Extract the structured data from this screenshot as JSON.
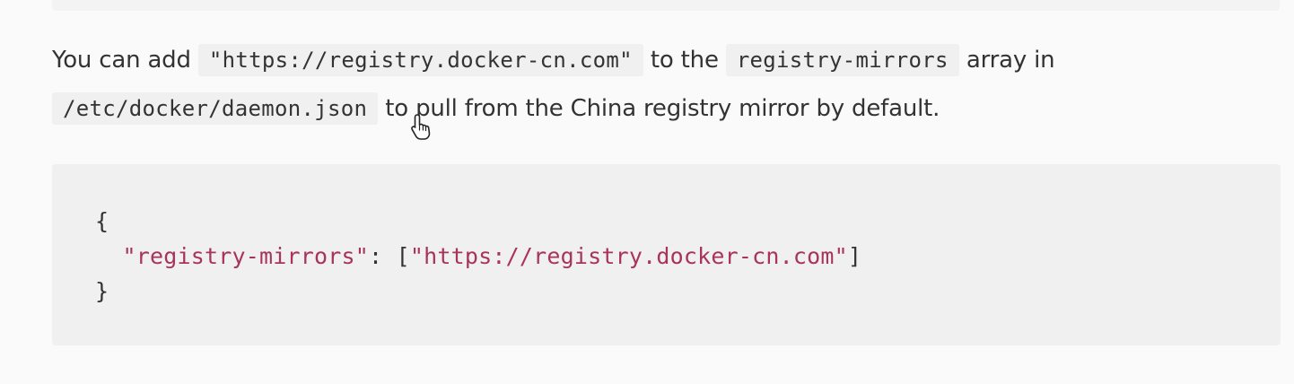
{
  "paragraph": {
    "text_1": "You can add ",
    "code_1": "\"https://registry.docker-cn.com\"",
    "text_2": " to the ",
    "code_2": "registry-mirrors",
    "text_3": " array in",
    "code_3": "/etc/docker/daemon.json",
    "text_4": " to pull from the China registry mirror by default."
  },
  "code_block": {
    "open_brace": "{",
    "indent": "  ",
    "key": "\"registry-mirrors\"",
    "colon": ": ",
    "bracket_open": "[",
    "value": "\"https://registry.docker-cn.com\"",
    "bracket_close": "]",
    "close_brace": "}"
  },
  "cursor": {
    "icon": "hand-pointer-icon"
  }
}
